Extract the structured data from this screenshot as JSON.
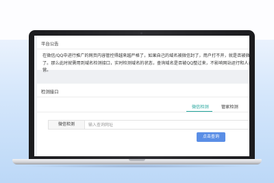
{
  "notice": {
    "title": "平台公告",
    "body": "在微信/QQ中进行推广的网页内容管控得越来越严格了，如果自己的域名被微信封了，用户打不开，就是否被微信屏蔽了。那么此时就需用到域名检测接口，实时检测域名的状态，查询域名是否被QQ整过来，不影响网站运行和人员的运营。"
  },
  "detector": {
    "title": "检测接口",
    "tabs": [
      {
        "label": "微信检测",
        "active": true
      },
      {
        "label": "管家检测",
        "active": false
      }
    ],
    "input": {
      "addon_label": "微信检测",
      "placeholder": "输入查询网址",
      "value": ""
    },
    "query_button": "点击查询"
  },
  "colors": {
    "accent_teal": "#20a39b",
    "button_blue": "#5a8ee6"
  }
}
